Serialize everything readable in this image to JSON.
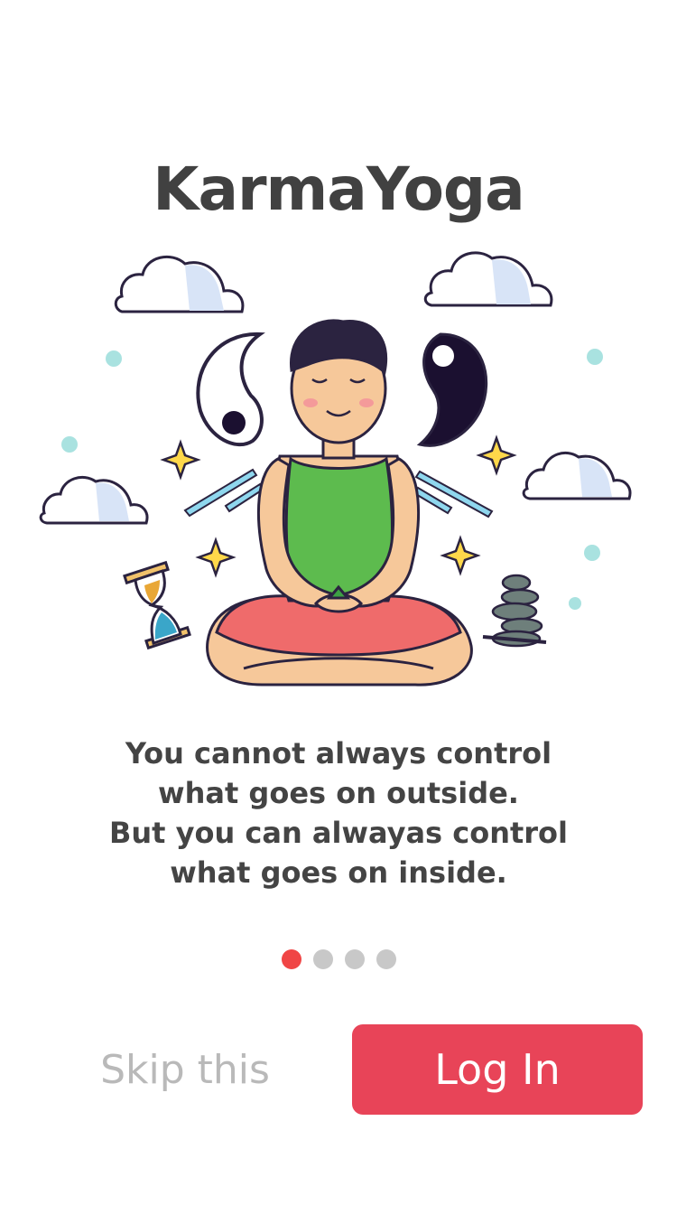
{
  "app": {
    "title": "KarmaYoga"
  },
  "illustration": {
    "icon": "meditating-person-illustration"
  },
  "quote": {
    "lines": [
      "You cannot always control",
      "what goes on outside.",
      "But you can alwayas control",
      "what goes on inside."
    ]
  },
  "pager": {
    "total": 4,
    "active_index": 0,
    "active_color": "#f04545",
    "inactive_color": "#c8c8c8"
  },
  "actions": {
    "skip_label": "Skip this",
    "login_label": "Log In",
    "login_color": "#e84458"
  }
}
